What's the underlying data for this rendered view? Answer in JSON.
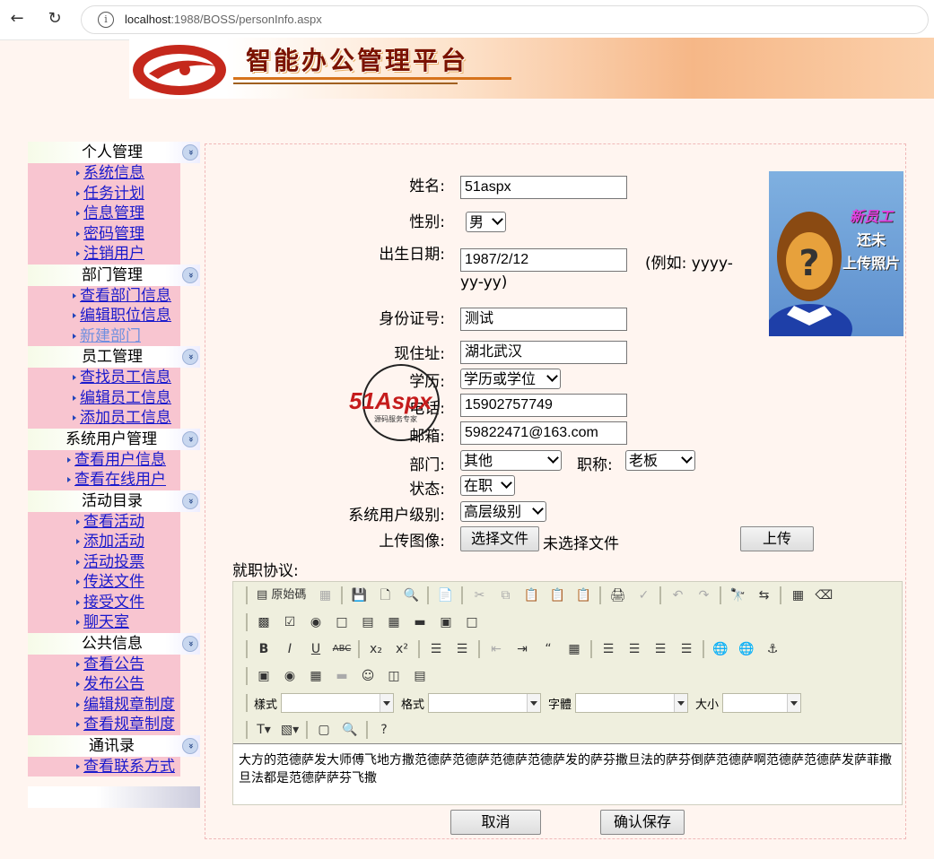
{
  "browser": {
    "url_host": "localhost",
    "url_rest": ":1988/BOSS/personInfo.aspx",
    "back_icon": "arrow-left",
    "reload_icon": "reload",
    "info_icon": "info"
  },
  "banner": {
    "title": "智能办公管理平台"
  },
  "sidebar": {
    "sections": [
      {
        "title": "个人管理",
        "items": [
          "系统信息",
          "任务计划",
          "信息管理",
          "密码管理",
          "注销用户"
        ]
      },
      {
        "title": "部门管理",
        "items": [
          "查看部门信息",
          "编辑职位信息",
          "新建部门"
        ]
      },
      {
        "title": "员工管理",
        "items": [
          "查找员工信息",
          "编辑员工信息",
          "添加员工信息"
        ]
      },
      {
        "title": "系统用户管理",
        "items": [
          "查看用户信息",
          "查看在线用户"
        ]
      },
      {
        "title": "活动目录",
        "items": [
          "查看活动",
          "添加活动",
          "活动投票",
          "传送文件",
          "接受文件",
          "聊天室"
        ]
      },
      {
        "title": "公共信息",
        "items": [
          "查看公告",
          "发布公告",
          "编辑规章制度",
          "查看规章制度"
        ]
      },
      {
        "title": "通讯录",
        "items": [
          "查看联系方式"
        ]
      }
    ]
  },
  "form": {
    "name_label": "姓名:",
    "name_value": "51aspx",
    "gender_label": "性别:",
    "gender_value": "男",
    "birth_label": "出生日期:",
    "birth_value": "1987/2/12",
    "birth_hint": "(例如: yyyy-",
    "birth_hint2": "yy-yy)",
    "id_label": "身份证号:",
    "id_value": "测试",
    "address_label": "现住址:",
    "address_value": "湖北武汉",
    "edu_label": "学历:",
    "edu_value": "学历或学位",
    "phone_label": "电话:",
    "phone_value": "15902757749",
    "email_label": "邮箱:",
    "email_value": "59822471@163.com",
    "dept_label": "部门:",
    "dept_value": "其他",
    "title_label": "职称:",
    "title_value": "老板",
    "status_label": "状态:",
    "status_value": "在职",
    "level_label": "系统用户级别:",
    "level_value": "高层级别",
    "upload_label": "上传图像:",
    "choose_file": "选择文件",
    "no_file": "未选择文件",
    "upload_button": "上传",
    "photo_line1": "新员工",
    "photo_line2": "还未",
    "photo_line3": "上传照片",
    "agreement_label": "就职协议:",
    "cancel_button": "取消",
    "save_button": "确认保存"
  },
  "editor": {
    "source_label": "原始碼",
    "style_label": "樣式",
    "format_label": "格式",
    "font_label": "字體",
    "size_label": "大小",
    "content": "大方的范德萨发大师傅飞地方撒范德萨范德萨范德萨范德萨发的萨芬撒旦法的萨芬倒萨范德萨啊范德萨范德萨发萨菲撒旦法都是范德萨萨芬飞撒"
  },
  "watermark": {
    "text": "51Aspx",
    "sub": "源码服务专家"
  }
}
